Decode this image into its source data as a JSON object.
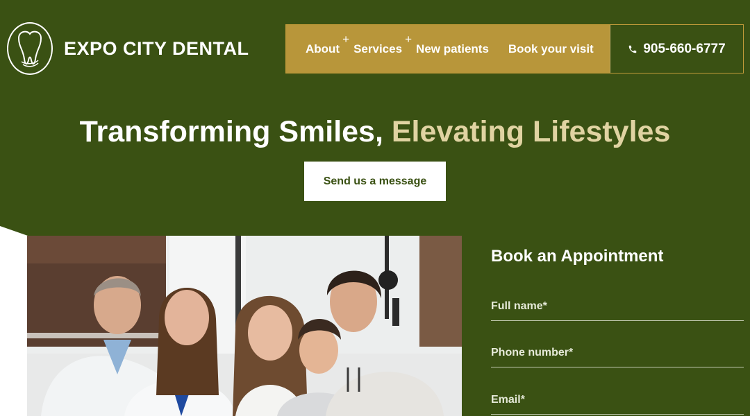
{
  "brand": {
    "name": "EXPO CITY DENTAL",
    "logo_icon": "tooth-icon"
  },
  "nav": {
    "items": [
      {
        "label": "About",
        "expand": "+"
      },
      {
        "label": "Services",
        "expand": "+"
      },
      {
        "label": "New patients"
      },
      {
        "label": "Book your visit"
      }
    ],
    "phone": "905-660-6777",
    "phone_icon": "phone-icon"
  },
  "hero": {
    "title_main": "Transforming Smiles,",
    "title_accent": "Elevating Lifestyles",
    "cta_label": "Send us a message"
  },
  "form": {
    "title": "Book an Appointment",
    "fields": [
      {
        "label": "Full name*"
      },
      {
        "label": "Phone number*"
      },
      {
        "label": "Email*"
      }
    ]
  },
  "colors": {
    "background": "#3a5113",
    "nav_gold": "#b8963a",
    "accent_text": "#e0d3a2",
    "white": "#ffffff"
  }
}
